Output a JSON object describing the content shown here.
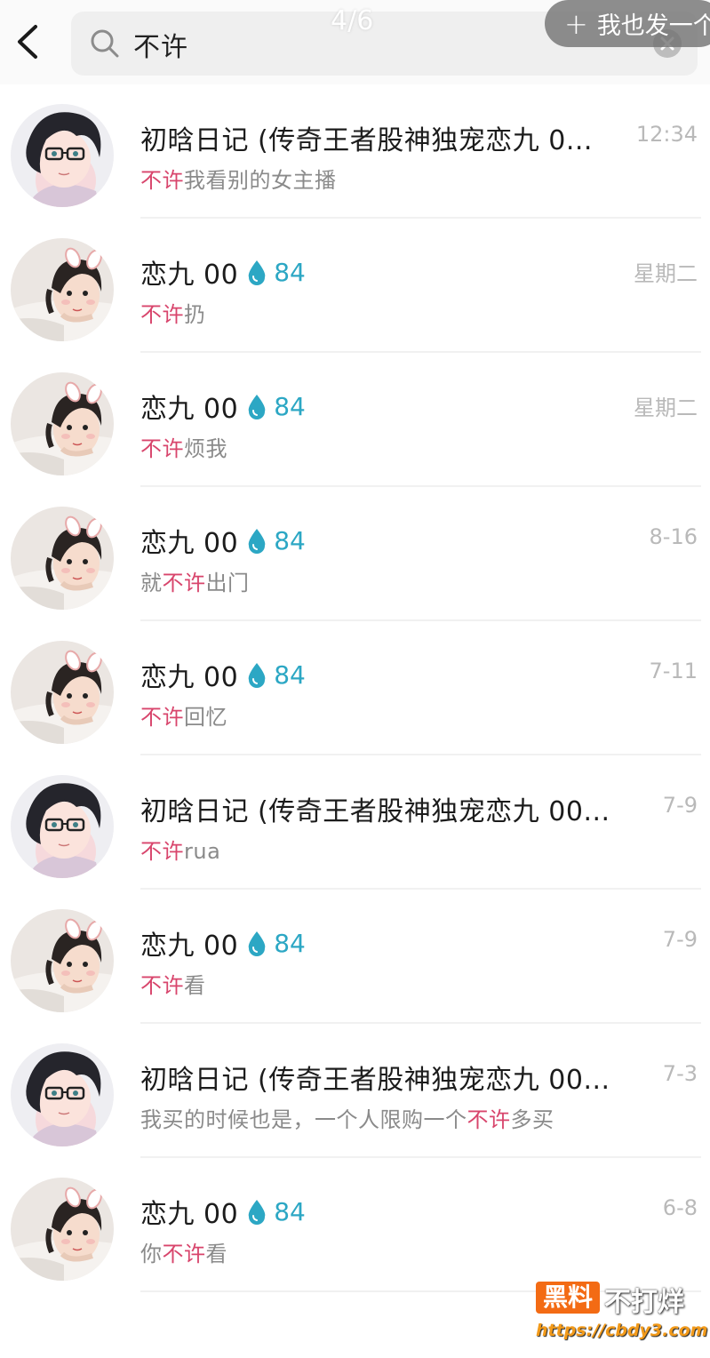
{
  "header": {
    "search_query": "不许",
    "page_counter": "4/6",
    "post_button": "我也发一个"
  },
  "colors": {
    "highlight": "#d8456c",
    "fire_count": "#2ca7c4",
    "timestamp": "#b9b9b9"
  },
  "results": [
    {
      "avatar": "boy-glasses",
      "name": "初晗日记 (传奇王者股神独宠恋九 0...",
      "count": "",
      "time": "12:34",
      "pre": "",
      "hl": "不许",
      "post": "我看别的女主播"
    },
    {
      "avatar": "girl-bunny",
      "name": "恋九 00",
      "count": "84",
      "time": "星期二",
      "pre": "",
      "hl": "不许",
      "post": "扔"
    },
    {
      "avatar": "girl-bunny",
      "name": "恋九 00",
      "count": "84",
      "time": "星期二",
      "pre": "",
      "hl": "不许",
      "post": "烦我"
    },
    {
      "avatar": "girl-bunny",
      "name": "恋九 00",
      "count": "84",
      "time": "8-16",
      "pre": "就",
      "hl": "不许",
      "post": "出门"
    },
    {
      "avatar": "girl-bunny",
      "name": "恋九 00",
      "count": "84",
      "time": "7-11",
      "pre": "",
      "hl": "不许",
      "post": "回忆"
    },
    {
      "avatar": "boy-glasses",
      "name": "初晗日记 (传奇王者股神独宠恋九 00...",
      "count": "",
      "time": "7-9",
      "pre": "",
      "hl": "不许",
      "post": "rua"
    },
    {
      "avatar": "girl-bunny",
      "name": "恋九 00",
      "count": "84",
      "time": "7-9",
      "pre": "",
      "hl": "不许",
      "post": "看"
    },
    {
      "avatar": "boy-glasses",
      "name": "初晗日记 (传奇王者股神独宠恋九 00...",
      "count": "",
      "time": "7-3",
      "pre": "我买的时候也是，一个人限购一个",
      "hl": "不许",
      "post": "多买"
    },
    {
      "avatar": "girl-bunny",
      "name": "恋九 00",
      "count": "84",
      "time": "6-8",
      "pre": "你",
      "hl": "不许",
      "post": "看"
    }
  ],
  "watermark": {
    "badge": "黑料",
    "text": "不打烊",
    "url": "https://cbdy3.com"
  }
}
